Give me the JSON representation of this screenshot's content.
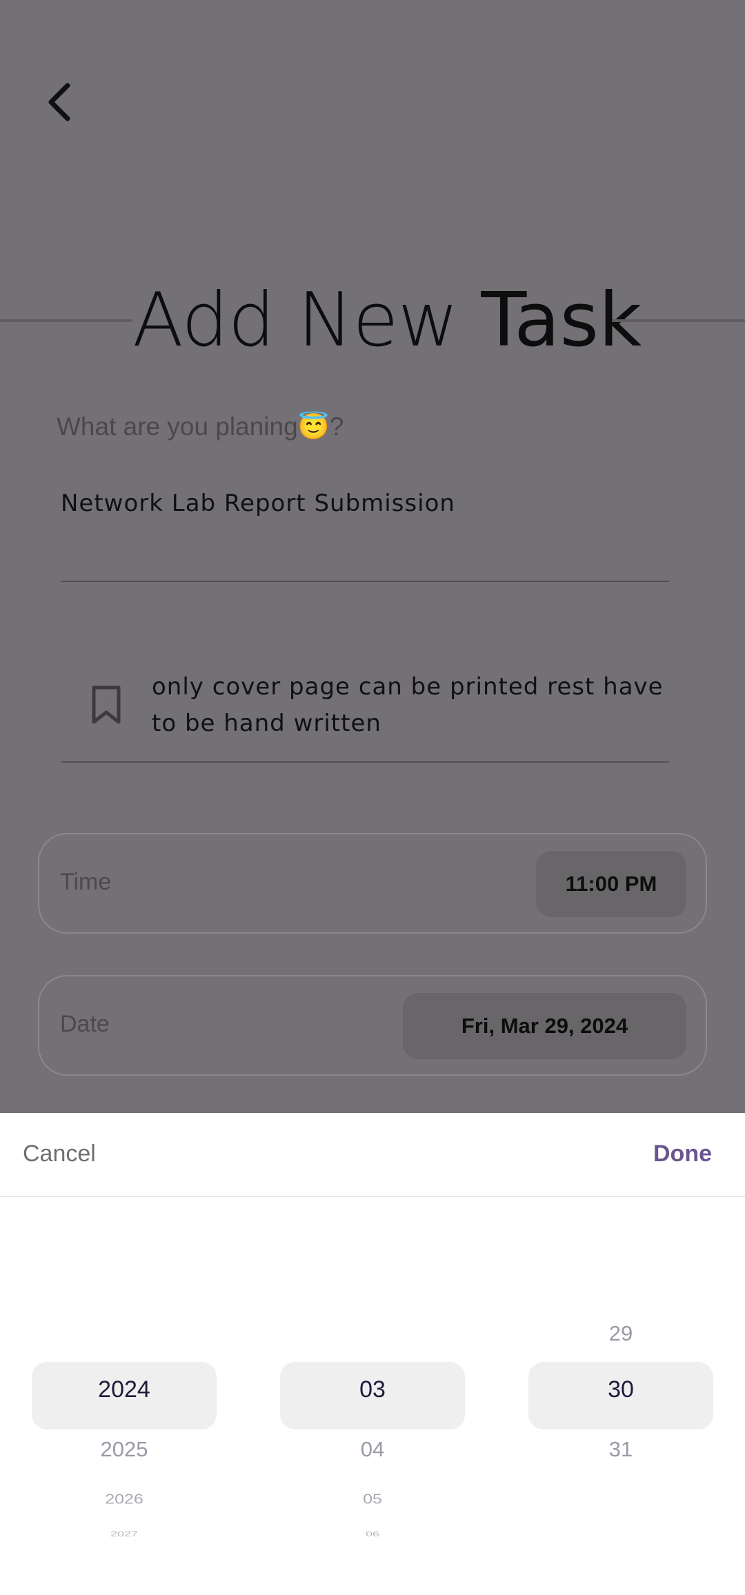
{
  "header": {
    "back_label": "Back"
  },
  "title": {
    "light": "Add New ",
    "bold": "Task"
  },
  "form": {
    "prompt": "What are you planing😇?",
    "task_name": "Network Lab Report Submission",
    "note": "only cover page can be printed rest have to be hand written",
    "time_label": "Time",
    "time_value": "11:00 PM",
    "date_label": "Date",
    "date_value": "Fri, Mar 29, 2024"
  },
  "picker": {
    "cancel_label": "Cancel",
    "done_label": "Done",
    "year": {
      "selected": "2024",
      "next": [
        "2025",
        "2026",
        "2027"
      ]
    },
    "month": {
      "selected": "03",
      "next": [
        "04",
        "05",
        "06"
      ]
    },
    "day": {
      "prev": "29",
      "selected": "30",
      "next": [
        "31"
      ]
    }
  },
  "colors": {
    "overlay": "#737175",
    "accent": "#6a558f",
    "selection_bg": "#efeff0"
  },
  "icons": {
    "back": "chevron-left-icon",
    "note": "bookmark-icon"
  }
}
